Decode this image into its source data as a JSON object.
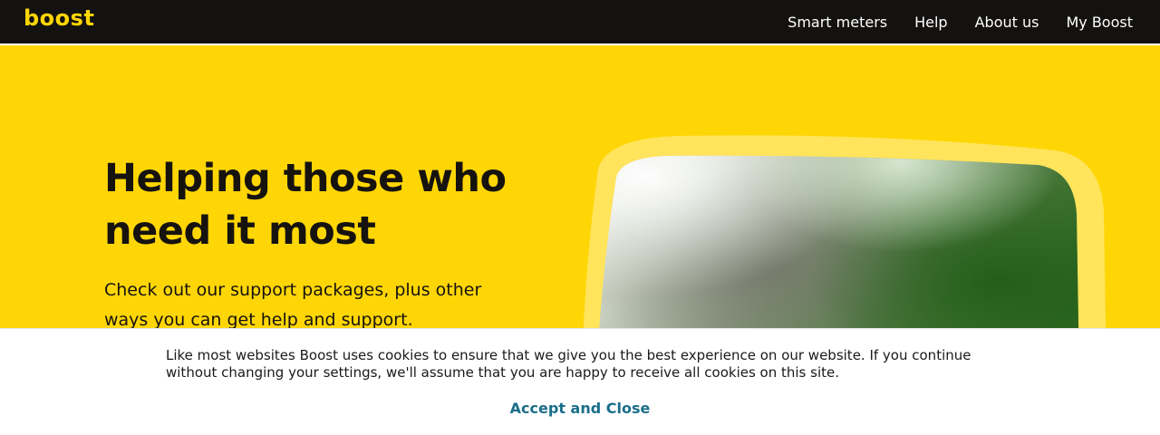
{
  "header": {
    "logo_text": "boost",
    "nav": [
      {
        "label": "Smart meters"
      },
      {
        "label": "Help"
      },
      {
        "label": "About us"
      },
      {
        "label": "My Boost"
      }
    ]
  },
  "hero": {
    "title_line1": "Helping those who",
    "title_line2": "need it most",
    "description": "Check out our support packages, plus other ways you can get help and support."
  },
  "cookie": {
    "message": "Like most websites Boost uses cookies to ensure that we give you the best experience on our website. If you continue without changing your settings, we'll assume that you are happy to receive all cookies on this site.",
    "accept_label": "Accept and Close"
  },
  "colors": {
    "brand_yellow": "#ffd605",
    "header_bg": "#141210",
    "link_teal": "#1a6e8a"
  }
}
